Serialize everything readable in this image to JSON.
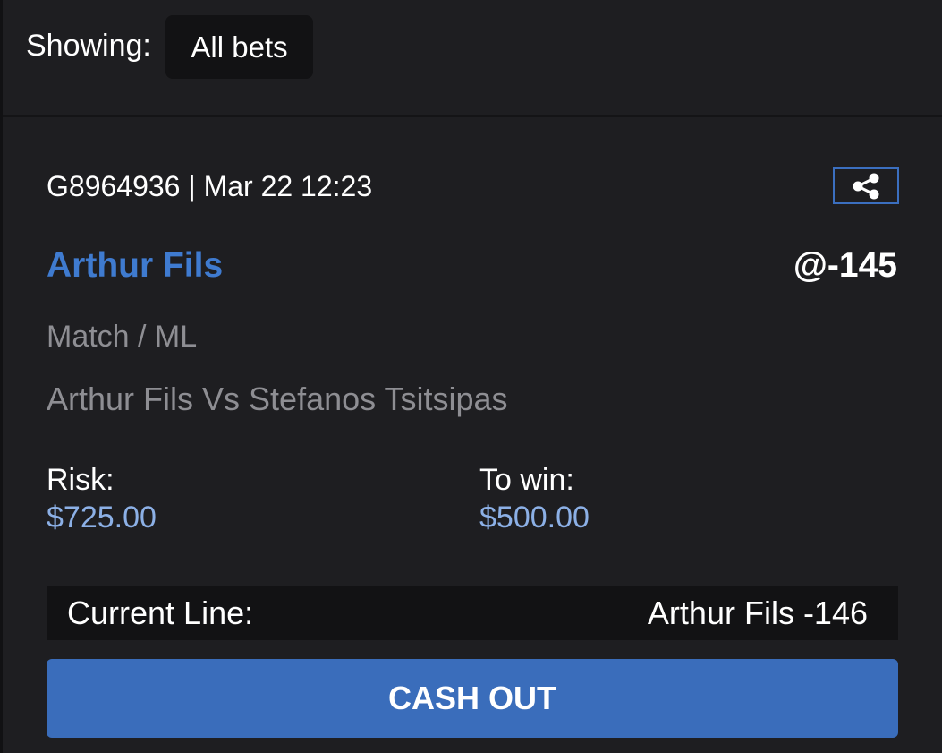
{
  "filter": {
    "label": "Showing:",
    "selected": "All bets"
  },
  "bet": {
    "meta": "G8964936 | Mar 22 12:23",
    "share_icon": "share-icon",
    "selection": "Arthur Fils",
    "odds": "@-145",
    "market": "Match / ML",
    "event": "Arthur Fils Vs Stefanos Tsitsipas",
    "risk_label": "Risk:",
    "risk_value": "$725.00",
    "win_label": "To win:",
    "win_value": "$500.00",
    "current_line_label": "Current Line:",
    "current_line_value": "Arthur Fils -146",
    "cashout_label": "CASH OUT"
  },
  "colors": {
    "background": "#1e1e21",
    "accent": "#3a6dbb",
    "selection": "#3f7bd0",
    "amount": "#8cb0e6",
    "muted": "#8e8e93"
  }
}
